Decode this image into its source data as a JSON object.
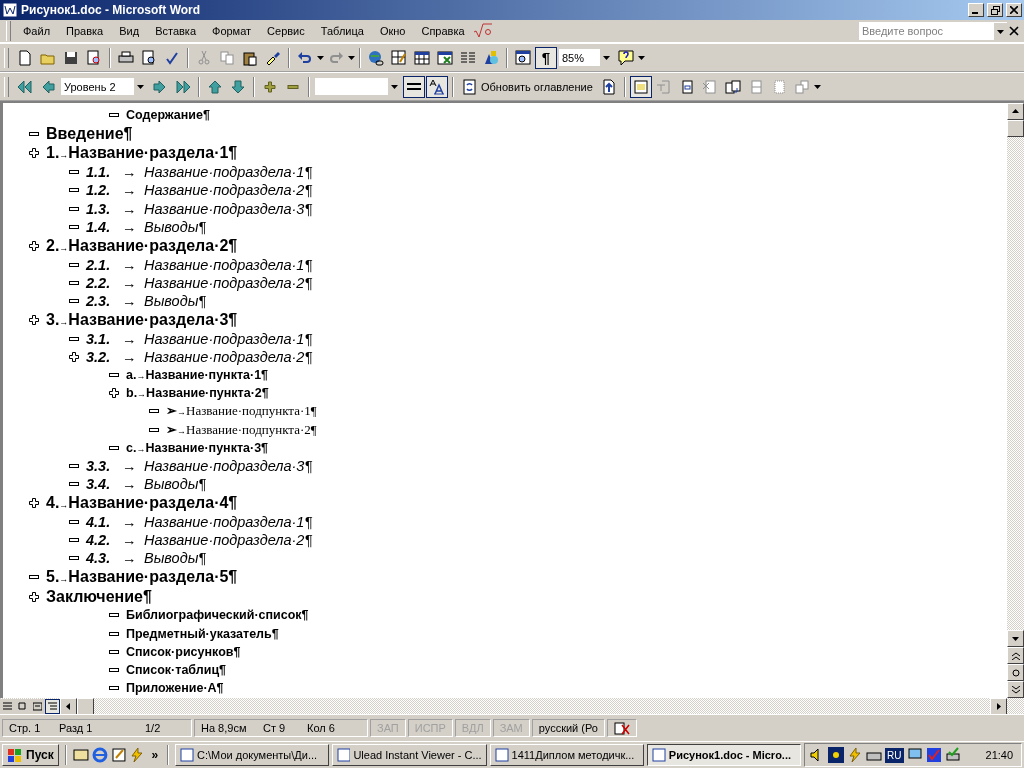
{
  "window": {
    "title": "Рисунок1.doc - Microsoft Word"
  },
  "menu": [
    "Файл",
    "Правка",
    "Вид",
    "Вставка",
    "Формат",
    "Сервис",
    "Таблица",
    "Окно",
    "Справка"
  ],
  "help_box": {
    "placeholder": "Введите вопрос"
  },
  "standard_toolbar": {
    "show_marks": {
      "label": "¶",
      "selected": true
    },
    "zoom": "85%"
  },
  "outline_toolbar": {
    "level": "Уровень 2",
    "lines_toggle": {
      "selected": true
    },
    "format_toggle": {
      "selected": true
    },
    "update_button": "Обновить оглавление",
    "master_toggle": {
      "selected": true
    }
  },
  "outline": [
    {
      "kind": "point",
      "text": "Содержание¶"
    },
    {
      "kind": "section",
      "text": "Введение¶"
    },
    {
      "kind": "section",
      "number": "1.",
      "leader": "→",
      "text": "Название·раздела·1¶",
      "children": [
        {
          "kind": "subsection",
          "number": "1.1.",
          "leader": "→",
          "text": "Название·подраздела·1¶"
        },
        {
          "kind": "subsection",
          "number": "1.2.",
          "leader": "→",
          "text": "Название·подраздела·2¶"
        },
        {
          "kind": "subsection",
          "number": "1.3.",
          "leader": "→",
          "text": "Название·подраздела·3¶"
        },
        {
          "kind": "subsection",
          "number": "1.4.",
          "leader": "→",
          "text": "Выводы¶"
        }
      ]
    },
    {
      "kind": "section",
      "number": "2.",
      "leader": "→",
      "text": "Название·раздела·2¶",
      "children": [
        {
          "kind": "subsection",
          "number": "2.1.",
          "leader": "→",
          "text": "Название·подраздела·1¶"
        },
        {
          "kind": "subsection",
          "number": "2.2.",
          "leader": "→",
          "text": "Название·подраздела·2¶"
        },
        {
          "kind": "subsection",
          "number": "2.3.",
          "leader": "→",
          "text": "Выводы¶"
        }
      ]
    },
    {
      "kind": "section",
      "number": "3.",
      "leader": "→",
      "text": "Название·раздела·3¶",
      "children": [
        {
          "kind": "subsection",
          "number": "3.1.",
          "leader": "→",
          "text": "Название·подраздела·1¶"
        },
        {
          "kind": "subsection",
          "number": "3.2.",
          "leader": "→",
          "text": "Название·подраздела·2¶",
          "children": [
            {
              "kind": "point",
              "number": "a.",
              "leader": "→",
              "text": "Название·пункта·1¶"
            },
            {
              "kind": "point",
              "number": "b.",
              "leader": "→",
              "text": "Название·пункта·2¶",
              "children": [
                {
                  "kind": "subpoint",
                  "number": "➢",
                  "leader": "→",
                  "text": "Название·подпункта·1¶"
                },
                {
                  "kind": "subpoint",
                  "number": "➢",
                  "leader": "→",
                  "text": "Название·подпункта·2¶"
                }
              ]
            },
            {
              "kind": "point",
              "number": "c.",
              "leader": "→",
              "text": "Название·пункта·3¶"
            }
          ]
        },
        {
          "kind": "subsection",
          "number": "3.3.",
          "leader": "→",
          "text": "Название·подраздела·3¶"
        },
        {
          "kind": "subsection",
          "number": "3.4.",
          "leader": "→",
          "text": "Выводы¶"
        }
      ]
    },
    {
      "kind": "section",
      "number": "4.",
      "leader": "→",
      "text": "Название·раздела·4¶",
      "children": [
        {
          "kind": "subsection",
          "number": "4.1.",
          "leader": "→",
          "text": "Название·подраздела·1¶"
        },
        {
          "kind": "subsection",
          "number": "4.2.",
          "leader": "→",
          "text": "Название·подраздела·2¶"
        },
        {
          "kind": "subsection",
          "number": "4.3.",
          "leader": "→",
          "text": "Выводы¶"
        }
      ]
    },
    {
      "kind": "section",
      "number": "5.",
      "leader": "→",
      "text": "Название·раздела·5¶"
    },
    {
      "kind": "section",
      "text": "Заключение¶",
      "children": [
        {
          "kind": "point",
          "text": "Библиографический·список¶"
        },
        {
          "kind": "point",
          "text": "Предметный·указатель¶"
        },
        {
          "kind": "point",
          "text": "Список·рисунков¶"
        },
        {
          "kind": "point",
          "text": "Список·таблиц¶"
        },
        {
          "kind": "point",
          "text": "Приложение·А¶"
        }
      ]
    }
  ],
  "view_buttons": [
    {
      "selected": false
    },
    {
      "selected": false
    },
    {
      "selected": false
    },
    {
      "selected": true
    }
  ],
  "status_bar": {
    "page_fields": [
      "Стр. 1",
      "Разд 1",
      "1/2"
    ],
    "position_fields": [
      "На 8,9см",
      "Ст 9",
      "Кол 6"
    ],
    "modes": [
      {
        "text": "ЗАП",
        "disabled": true
      },
      {
        "text": "ИСПР",
        "disabled": true
      },
      {
        "text": "ВДЛ",
        "disabled": true
      },
      {
        "text": "ЗАМ",
        "disabled": true
      }
    ],
    "language": "русский (Ро"
  },
  "taskbar": {
    "start": "Пуск",
    "more": "»",
    "tasks": [
      {
        "label": "C:\\Мои документы\\Ди...",
        "selected": false
      },
      {
        "label": "Ulead Instant Viewer - C...",
        "selected": false
      },
      {
        "label": "1411Диплом методичк...",
        "selected": false
      },
      {
        "label": "Рисунок1.doc - Micro...",
        "selected": true
      }
    ],
    "tray_lang": "RU",
    "clock": "21:40"
  }
}
